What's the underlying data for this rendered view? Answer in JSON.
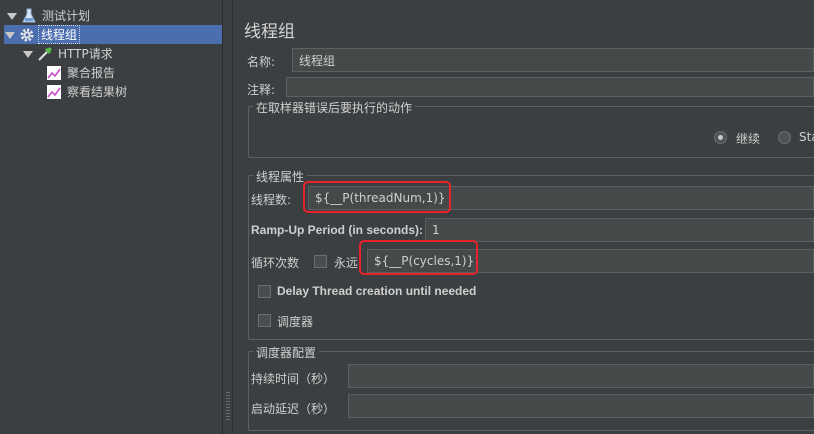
{
  "tree": {
    "plan_label": "测试计划",
    "group_label": "线程组",
    "http_label": "HTTP请求",
    "report_label": "聚合报告",
    "result_tree_label": "察看结果树"
  },
  "main": {
    "title": "线程组",
    "name_label": "名称:",
    "name_value": "线程组",
    "comment_label": "注释:",
    "comment_value": "",
    "error_action": {
      "legend": "在取样器错误后要执行的动作",
      "continue_label": "继续",
      "start_next_label": "Sta"
    },
    "thread_props": {
      "legend": "线程属性",
      "thread_count_label": "线程数:",
      "thread_count_value": "${__P(threadNum,1)}",
      "rampup_label": "Ramp-Up Period (in seconds):",
      "rampup_value": "1",
      "loop_label": "循环次数",
      "forever_label": "永远",
      "loop_value": "${__P(cycles,1)}",
      "delay_label": "Delay Thread creation until needed",
      "scheduler_label": "调度器"
    },
    "scheduler_config": {
      "legend": "调度器配置",
      "duration_label": "持续时间（秒）",
      "duration_value": "",
      "startup_delay_label": "启动延迟（秒）",
      "startup_delay_value": ""
    }
  },
  "colors": {
    "highlight": "#e8232a",
    "selection": "#4b6eaf"
  }
}
